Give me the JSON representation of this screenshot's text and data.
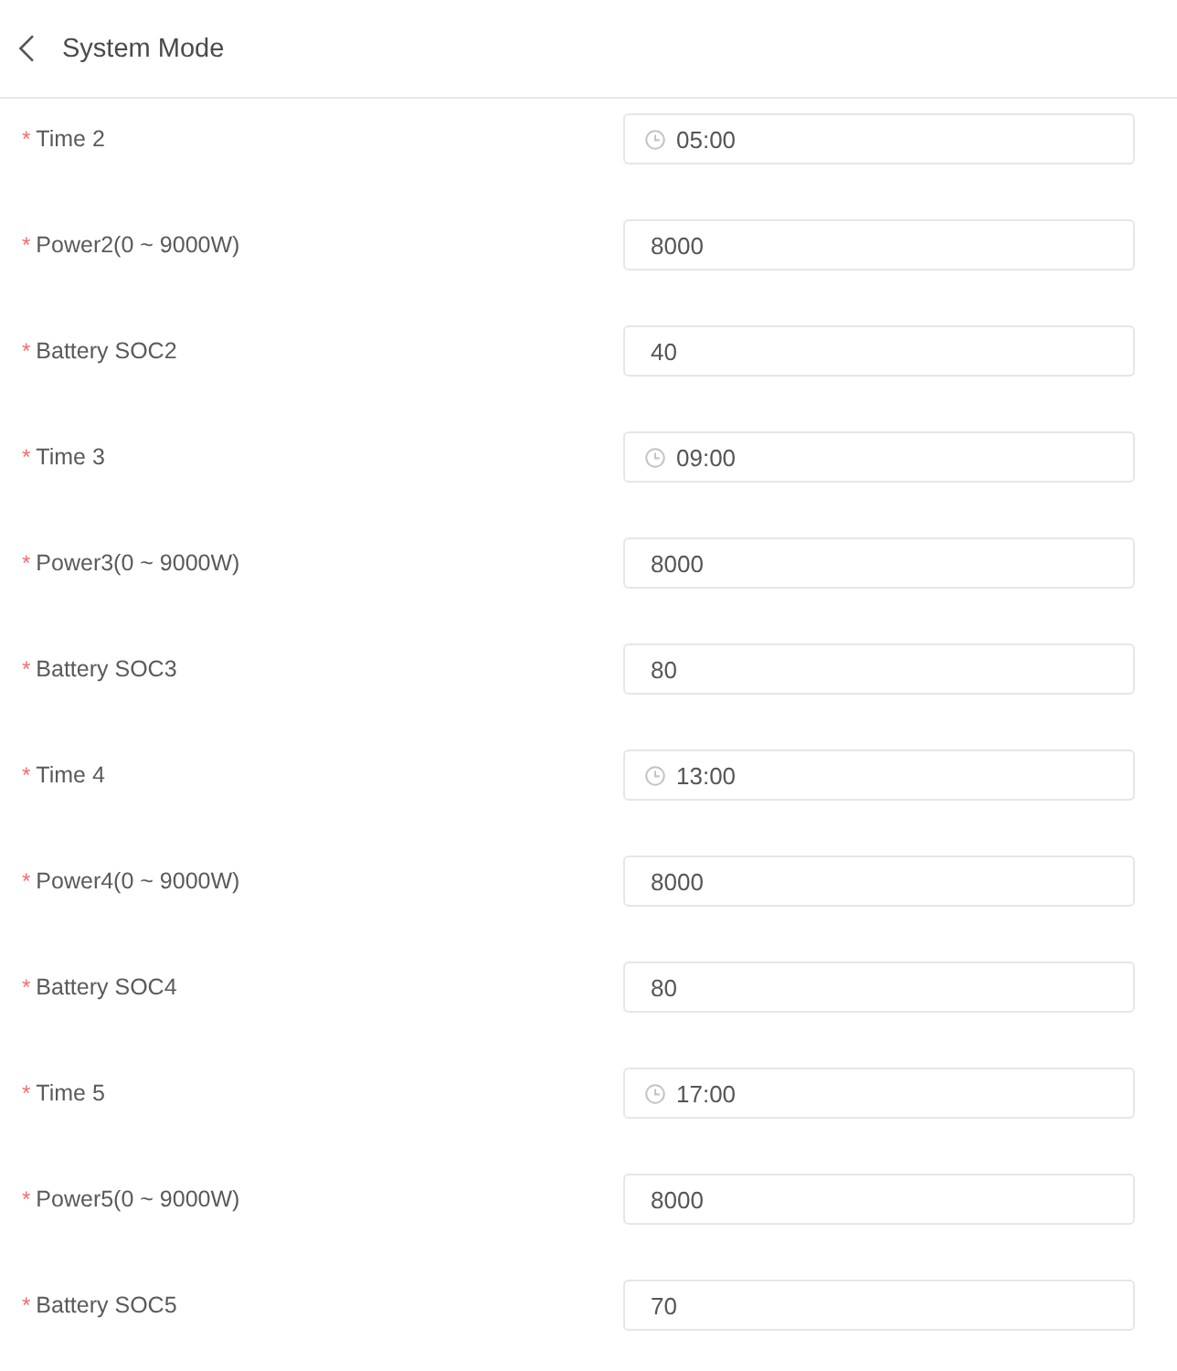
{
  "header": {
    "title": "System Mode"
  },
  "fields": [
    {
      "kind": "time",
      "required_mark": "*",
      "label": "Time 2",
      "value": "05:00"
    },
    {
      "kind": "number",
      "required_mark": "*",
      "label": "Power2(0 ~ 9000W)",
      "value": "8000"
    },
    {
      "kind": "number",
      "required_mark": "*",
      "label": "Battery SOC2",
      "value": "40"
    },
    {
      "kind": "time",
      "required_mark": "*",
      "label": "Time 3",
      "value": "09:00"
    },
    {
      "kind": "number",
      "required_mark": "*",
      "label": "Power3(0 ~ 9000W)",
      "value": "8000"
    },
    {
      "kind": "number",
      "required_mark": "*",
      "label": "Battery SOC3",
      "value": "80"
    },
    {
      "kind": "time",
      "required_mark": "*",
      "label": "Time 4",
      "value": "13:00"
    },
    {
      "kind": "number",
      "required_mark": "*",
      "label": "Power4(0 ~ 9000W)",
      "value": "8000"
    },
    {
      "kind": "number",
      "required_mark": "*",
      "label": "Battery SOC4",
      "value": "80"
    },
    {
      "kind": "time",
      "required_mark": "*",
      "label": "Time 5",
      "value": "17:00"
    },
    {
      "kind": "number",
      "required_mark": "*",
      "label": "Power5(0 ~ 9000W)",
      "value": "8000"
    },
    {
      "kind": "number",
      "required_mark": "*",
      "label": "Battery SOC5",
      "value": "70"
    }
  ]
}
